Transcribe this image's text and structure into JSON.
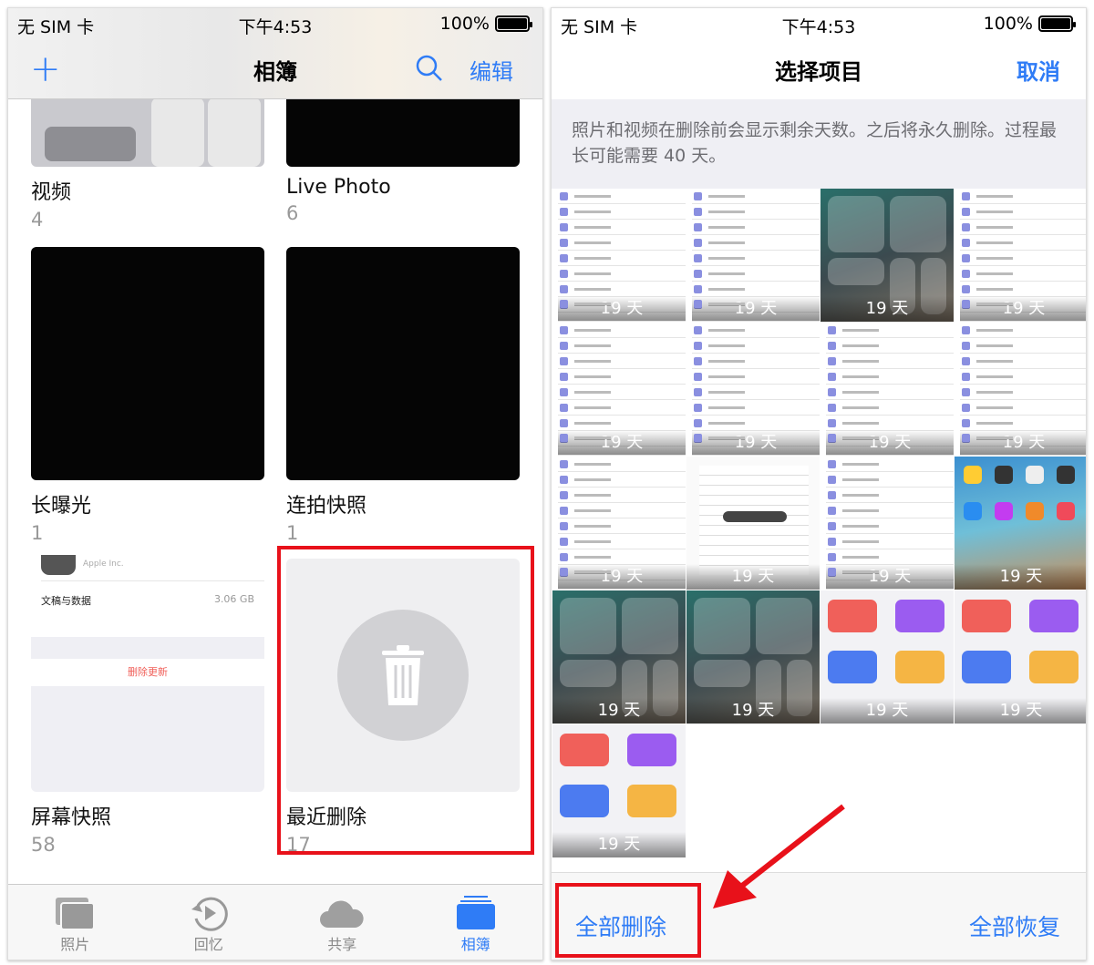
{
  "status": {
    "carrier": "无 SIM 卡",
    "time": "下午4:53",
    "battery": "100%",
    "battery_level": 100
  },
  "left": {
    "nav": {
      "add_icon": "plus-icon",
      "title": "相簿",
      "search_icon": "search-icon",
      "edit": "编辑"
    },
    "albums": [
      {
        "name": "视频",
        "count": "4"
      },
      {
        "name": "Live Photo",
        "count": "6"
      },
      {
        "name": "长曝光",
        "count": "1"
      },
      {
        "name": "连拍快照",
        "count": "1"
      },
      {
        "name": "屏幕快照",
        "count": "58",
        "thumb": {
          "vendor": "Apple Inc.",
          "row_label": "文稿与数据",
          "row_value": "3.06 GB",
          "action": "删除更新"
        }
      },
      {
        "name": "最近删除",
        "count": "17",
        "icon": "trash-icon"
      }
    ],
    "tabs": [
      {
        "label": "照片",
        "icon": "photos-icon"
      },
      {
        "label": "回忆",
        "icon": "memories-icon"
      },
      {
        "label": "共享",
        "icon": "cloud-icon"
      },
      {
        "label": "相簿",
        "icon": "albums-icon",
        "active": true
      }
    ]
  },
  "right": {
    "nav": {
      "title": "选择项目",
      "cancel": "取消"
    },
    "info": "照片和视频在删除前会显示剩余天数。之后将永久删除。过程最长可能需要 40 天。",
    "items": [
      "19 天",
      "19 天",
      "19 天",
      "19 天",
      "19 天",
      "19 天",
      "19 天",
      "19 天",
      "19 天",
      "19 天",
      "19 天",
      "19 天",
      "19 天",
      "19 天",
      "19 天",
      "19 天",
      "19 天"
    ],
    "delete_all": "全部删除",
    "recover_all": "全部恢复"
  },
  "colors": {
    "accent": "#2f7cf6",
    "highlight": "#e8111a"
  }
}
